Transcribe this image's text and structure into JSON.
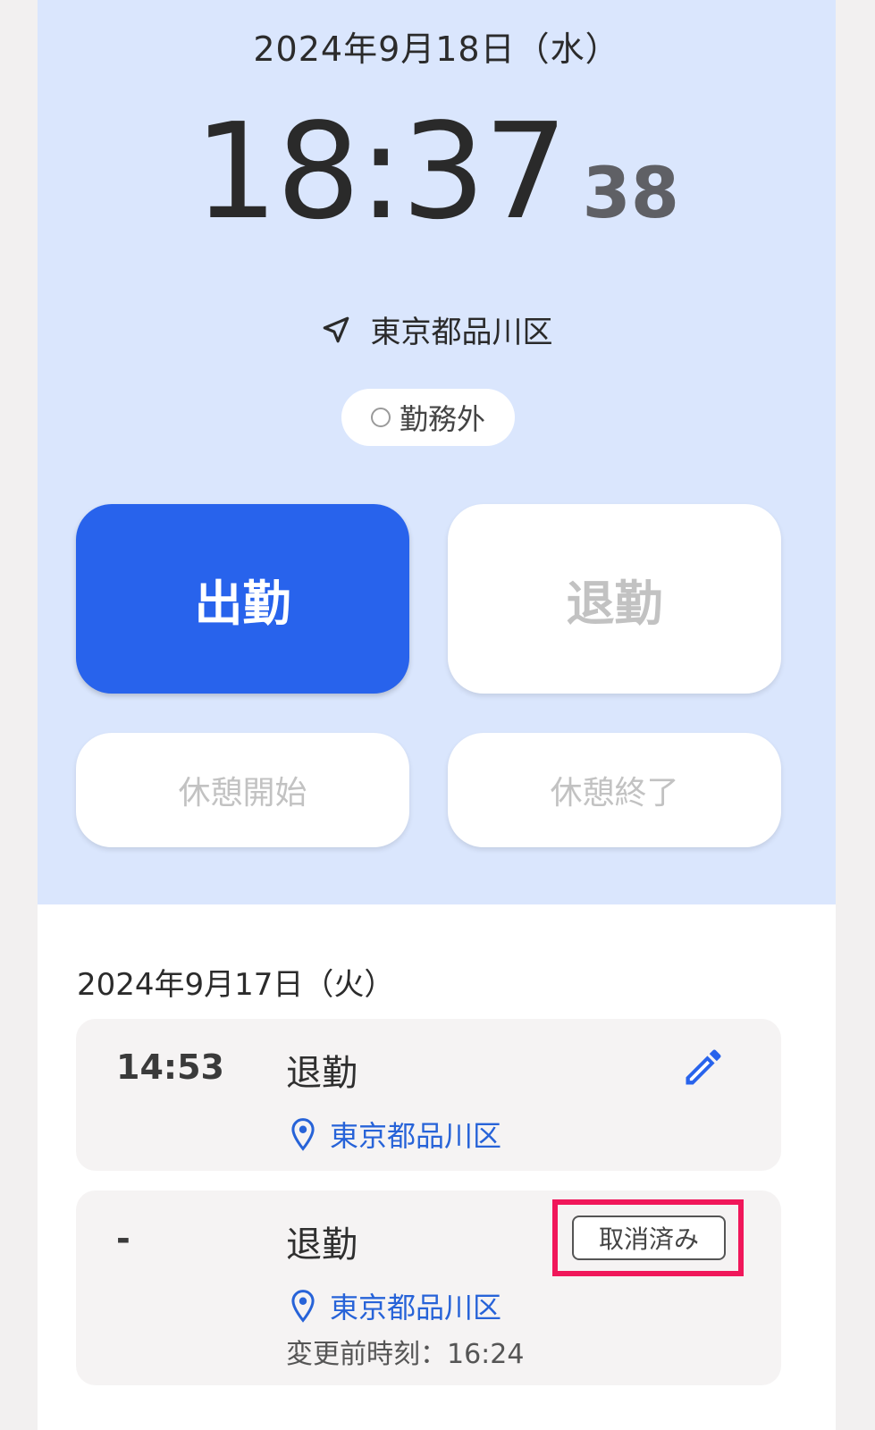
{
  "clock": {
    "date": "2024年9月18日（水）",
    "time_hm": "18:37",
    "time_sec": "38",
    "location": "東京都品川区",
    "status": "勤務外"
  },
  "actions": {
    "clock_in": "出勤",
    "clock_out": "退勤",
    "break_start": "休憩開始",
    "break_end": "休憩終了"
  },
  "history": {
    "date": "2024年9月17日（火）",
    "records": [
      {
        "time": "14:53",
        "type": "退勤",
        "location": "東京都品川区"
      },
      {
        "time": "-",
        "type": "退勤",
        "location": "東京都品川区",
        "badge": "取消済み",
        "original_time": "変更前時刻：16:24"
      }
    ]
  },
  "colors": {
    "panel_bg": "#dae6fd",
    "primary": "#2863ec",
    "link": "#2763d8",
    "highlight": "#f0175a"
  },
  "icons": {
    "location_arrow": "navigation-arrow-icon",
    "pin": "map-pin-icon",
    "edit": "pencil-icon"
  }
}
